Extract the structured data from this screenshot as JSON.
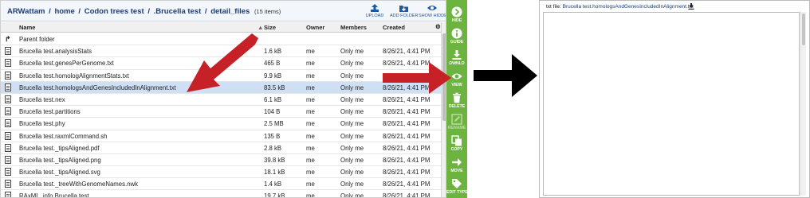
{
  "breadcrumb": {
    "parts": [
      "ARWattam",
      "home",
      "Codon trees test",
      ".Brucella test",
      "detail_files"
    ],
    "separator": "/",
    "item_count": "(15 items)"
  },
  "toolbar": {
    "upload": "UPLOAD",
    "add_folder": "ADD FOLDER",
    "show_hidden": "SHOW HIDDEN"
  },
  "table": {
    "columns": {
      "name": "Name",
      "size": "Size",
      "owner": "Owner",
      "members": "Members",
      "created": "Created"
    },
    "rows": [
      {
        "name": "Parent folder",
        "size": "",
        "owner": "",
        "members": "",
        "created": "",
        "icon": "up-arrow-icon"
      },
      {
        "name": "Brucella test.analysisStats",
        "size": "1.6 kB",
        "owner": "me",
        "members": "Only me",
        "created": "8/26/21, 4:41 PM",
        "icon": "file-icon"
      },
      {
        "name": "Brucella test.genesPerGenome.txt",
        "size": "465 B",
        "owner": "me",
        "members": "Only me",
        "created": "8/26/21, 4:41 PM",
        "icon": "file-icon"
      },
      {
        "name": "Brucella test.homologAlignmentStats.txt",
        "size": "9.9 kB",
        "owner": "me",
        "members": "Only me",
        "created": "8/26/21, 4:41 PM",
        "icon": "file-icon"
      },
      {
        "name": "Brucella test.homologsAndGenesIncludedInAlignment.txt",
        "size": "83.5 kB",
        "owner": "me",
        "members": "Only me",
        "created": "8/26/21, 4:41 PM",
        "icon": "file-icon",
        "selected": true
      },
      {
        "name": "Brucella test.nex",
        "size": "6.1 kB",
        "owner": "me",
        "members": "Only me",
        "created": "8/26/21, 4:41 PM",
        "icon": "file-icon"
      },
      {
        "name": "Brucella test.partitions",
        "size": "104 B",
        "owner": "me",
        "members": "Only me",
        "created": "8/26/21, 4:41 PM",
        "icon": "file-icon"
      },
      {
        "name": "Brucella test.phy",
        "size": "2.5 MB",
        "owner": "me",
        "members": "Only me",
        "created": "8/26/21, 4:41 PM",
        "icon": "file-icon"
      },
      {
        "name": "Brucella test.raxmlCommand.sh",
        "size": "135 B",
        "owner": "me",
        "members": "Only me",
        "created": "8/26/21, 4:41 PM",
        "icon": "file-icon"
      },
      {
        "name": "Brucella test._tipsAligned.pdf",
        "size": "2.8 kB",
        "owner": "me",
        "members": "Only me",
        "created": "8/26/21, 4:41 PM",
        "icon": "file-icon"
      },
      {
        "name": "Brucella test._tipsAligned.png",
        "size": "39.8 kB",
        "owner": "me",
        "members": "Only me",
        "created": "8/26/21, 4:41 PM",
        "icon": "file-icon"
      },
      {
        "name": "Brucella test._tipsAligned.svg",
        "size": "18.1 kB",
        "owner": "me",
        "members": "Only me",
        "created": "8/26/21, 4:41 PM",
        "icon": "file-icon"
      },
      {
        "name": "Brucella test._treeWithGenomeNames.nwk",
        "size": "1.4 kB",
        "owner": "me",
        "members": "Only me",
        "created": "8/26/21, 4:41 PM",
        "icon": "file-icon"
      },
      {
        "name": "RAxML_info.Brucella test",
        "size": "19.7 kB",
        "owner": "me",
        "members": "Only me",
        "created": "8/26/21, 4:41 PM",
        "icon": "file-icon"
      }
    ]
  },
  "actions": [
    {
      "label": "HIDE",
      "icon": "chevron-right-icon",
      "enabled": true
    },
    {
      "label": "GUIDE",
      "icon": "info-icon",
      "enabled": true
    },
    {
      "label": "DWNLD",
      "icon": "download-icon",
      "enabled": true
    },
    {
      "label": "VIEW",
      "icon": "eye-icon",
      "enabled": true
    },
    {
      "label": "DELETE",
      "icon": "trash-icon",
      "enabled": true
    },
    {
      "label": "RENAME",
      "icon": "pencil-icon",
      "enabled": false
    },
    {
      "label": "COPY",
      "icon": "copy-icon",
      "enabled": true
    },
    {
      "label": "MOVE",
      "icon": "arrow-right-icon",
      "enabled": true
    },
    {
      "label": "EDIT TYPE",
      "icon": "tag-icon",
      "enabled": true
    }
  ],
  "viewer": {
    "title_prefix": "txt file:",
    "file_name": "Brucella test.homologsAndGenesIncludedInAlignment.txt"
  },
  "colors": {
    "action_bar": "#6db33f",
    "annotation_arrow": "#c62127",
    "selected_row": "#cfe0f5",
    "breadcrumb_text": "#1d3e73"
  }
}
